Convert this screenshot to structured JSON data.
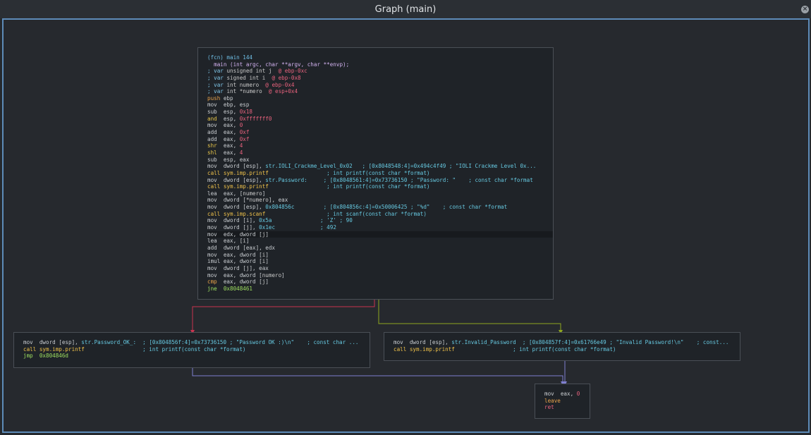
{
  "window": {
    "title": "Graph (main)",
    "close_label": "×"
  },
  "colors": {
    "border_accent": "#5d8bb8",
    "edge_false": "#c8334f",
    "edge_true": "#8fa61e",
    "edge_jump": "#7f7fd0"
  },
  "nodes": {
    "main": {
      "lines": [
        [
          [
            "c-fcn",
            "(fcn) main 144"
          ]
        ],
        [
          [
            "c-sig",
            "  main (int argc, char **argv, char **envp);"
          ]
        ],
        [
          [
            "c-semi",
            "; var "
          ],
          [
            "c-var",
            "unsigned int j "
          ],
          [
            "c-red",
            " @ ebp-0xc"
          ]
        ],
        [
          [
            "c-semi",
            "; var "
          ],
          [
            "c-var",
            "signed int i "
          ],
          [
            "c-red",
            " @ ebp-0x8"
          ]
        ],
        [
          [
            "c-semi",
            "; var "
          ],
          [
            "c-var",
            "int numero "
          ],
          [
            "c-red",
            " @ ebp-0x4"
          ]
        ],
        [
          [
            "c-semi",
            "; var "
          ],
          [
            "c-var",
            "int *numero "
          ],
          [
            "c-red",
            " @ esp+0x4"
          ]
        ],
        [
          [
            "c-push",
            "push "
          ],
          [
            "c-reg",
            "ebp"
          ]
        ],
        [
          [
            "c-mov",
            "mov  "
          ],
          [
            "c-reg",
            "ebp, esp"
          ]
        ],
        [
          [
            "c-mov",
            "sub  "
          ],
          [
            "c-reg",
            "esp, "
          ],
          [
            "c-num",
            "0x18"
          ]
        ],
        [
          [
            "c-and",
            "and  "
          ],
          [
            "c-reg",
            "esp, "
          ],
          [
            "c-num",
            "0xfffffff0"
          ]
        ],
        [
          [
            "c-mov",
            "mov  "
          ],
          [
            "c-reg",
            "eax, "
          ],
          [
            "c-num",
            "0"
          ]
        ],
        [
          [
            "c-mov",
            "add  "
          ],
          [
            "c-reg",
            "eax, "
          ],
          [
            "c-num",
            "0xf"
          ]
        ],
        [
          [
            "c-mov",
            "add  "
          ],
          [
            "c-reg",
            "eax, "
          ],
          [
            "c-num",
            "0xf"
          ]
        ],
        [
          [
            "c-and",
            "shr  "
          ],
          [
            "c-reg",
            "eax, "
          ],
          [
            "c-num",
            "4"
          ]
        ],
        [
          [
            "c-and",
            "shl  "
          ],
          [
            "c-reg",
            "eax, "
          ],
          [
            "c-num",
            "4"
          ]
        ],
        [
          [
            "c-mov",
            "sub  "
          ],
          [
            "c-reg",
            "esp, eax"
          ]
        ],
        [
          [
            "c-mov",
            "mov  "
          ],
          [
            "c-reg",
            "dword [esp], "
          ],
          [
            "c-str",
            "str.IOLI_Crackme_Level_0x02"
          ],
          [
            "c-cmt",
            "   ; [0x8048548:4]=0x494c4f49 ; \"IOLI Crackme Level 0x..."
          ]
        ],
        [
          [
            "c-call",
            "call "
          ],
          [
            "c-sym",
            "sym.imp.printf"
          ],
          [
            "c-cmt",
            "                  ; int printf(const char *format)"
          ]
        ],
        [
          [
            "c-mov",
            "mov  "
          ],
          [
            "c-reg",
            "dword [esp], "
          ],
          [
            "c-str",
            "str.Password:"
          ],
          [
            "c-cmt",
            "     ; [0x8048561:4]=0x73736150 ; \"Password: \"    ; const char *format"
          ]
        ],
        [
          [
            "c-call",
            "call "
          ],
          [
            "c-sym",
            "sym.imp.printf"
          ],
          [
            "c-cmt",
            "                  ; int printf(const char *format)"
          ]
        ],
        [
          [
            "c-mov",
            "lea  "
          ],
          [
            "c-reg",
            "eax, ["
          ],
          [
            "c-var",
            "numero"
          ],
          [
            "c-reg",
            "]"
          ]
        ],
        [
          [
            "c-mov",
            "mov  "
          ],
          [
            "c-reg",
            "dword ["
          ],
          [
            "c-var",
            "*numero"
          ],
          [
            "c-reg",
            "], eax"
          ]
        ],
        [
          [
            "c-mov",
            "mov  "
          ],
          [
            "c-reg",
            "dword [esp], "
          ],
          [
            "c-str",
            "0x804856c"
          ],
          [
            "c-cmt",
            "         ; [0x804856c:4]=0x50006425 ; \"%d\"    ; const char *format"
          ]
        ],
        [
          [
            "c-call",
            "call "
          ],
          [
            "c-sym",
            "sym.imp.scanf"
          ],
          [
            "c-cmt",
            "                   ; int scanf(const char *format)"
          ]
        ],
        [
          [
            "c-mov",
            "mov  "
          ],
          [
            "c-reg",
            "dword ["
          ],
          [
            "c-var",
            "i"
          ],
          [
            "c-reg",
            "], "
          ],
          [
            "c-str",
            "0x5a"
          ],
          [
            "c-cmt",
            "               ; 'Z' ; 90"
          ]
        ],
        [
          [
            "c-mov",
            "mov  "
          ],
          [
            "c-reg",
            "dword ["
          ],
          [
            "c-var",
            "j"
          ],
          [
            "c-reg",
            "], "
          ],
          [
            "c-str",
            "0x1ec"
          ],
          [
            "c-cmt",
            "              ; 492"
          ]
        ],
        [
          [
            "c-mov",
            "mov  "
          ],
          [
            "c-reg",
            "edx, dword ["
          ],
          [
            "c-var",
            "j"
          ],
          [
            "c-reg",
            "]"
          ]
        ],
        [
          [
            "c-mov",
            "lea  "
          ],
          [
            "c-reg",
            "eax, ["
          ],
          [
            "c-var",
            "i"
          ],
          [
            "c-reg",
            "]"
          ]
        ],
        [
          [
            "c-mov",
            "add  "
          ],
          [
            "c-reg",
            "dword [eax], edx"
          ]
        ],
        [
          [
            "c-mov",
            "mov  "
          ],
          [
            "c-reg",
            "eax, dword ["
          ],
          [
            "c-var",
            "i"
          ],
          [
            "c-reg",
            "]"
          ]
        ],
        [
          [
            "c-mov",
            "imul "
          ],
          [
            "c-reg",
            "eax, dword ["
          ],
          [
            "c-var",
            "i"
          ],
          [
            "c-reg",
            "]"
          ]
        ],
        [
          [
            "c-mov",
            "mov  "
          ],
          [
            "c-reg",
            "dword ["
          ],
          [
            "c-var",
            "j"
          ],
          [
            "c-reg",
            "], eax"
          ]
        ],
        [
          [
            "c-mov",
            "mov  "
          ],
          [
            "c-reg",
            "eax, dword ["
          ],
          [
            "c-var",
            "numero"
          ],
          [
            "c-reg",
            "]"
          ]
        ],
        [
          [
            "c-cmp",
            "cmp  "
          ],
          [
            "c-reg",
            "eax, dword ["
          ],
          [
            "c-var",
            "j"
          ],
          [
            "c-reg",
            "]"
          ]
        ],
        [
          [
            "c-jmp",
            "jne  "
          ],
          [
            "c-jmp",
            "0x8048461"
          ]
        ]
      ],
      "highlight_index": 26
    },
    "ok": {
      "lines": [
        [
          [
            "c-mov",
            "mov  "
          ],
          [
            "c-reg",
            "dword [esp], "
          ],
          [
            "c-str",
            "str.Password_OK_:"
          ],
          [
            "c-cmt",
            "  ; [0x804856f:4]=0x73736150 ; \"Password OK :)\\n\"    ; const char ..."
          ]
        ],
        [
          [
            "c-call",
            "call "
          ],
          [
            "c-sym",
            "sym.imp.printf"
          ],
          [
            "c-cmt",
            "                  ; int printf(const char *format)"
          ]
        ],
        [
          [
            "c-jmp",
            "jmp  "
          ],
          [
            "c-jmp",
            "0x804846d"
          ]
        ]
      ]
    },
    "invalid": {
      "lines": [
        [
          [
            "c-mov",
            "mov  "
          ],
          [
            "c-reg",
            "dword [esp], "
          ],
          [
            "c-str",
            "str.Invalid_Password"
          ],
          [
            "c-cmt",
            "  ; [0x804857f:4]=0x61766e49 ; \"Invalid Password!\\n\"    ; const..."
          ]
        ],
        [
          [
            "c-call",
            "call "
          ],
          [
            "c-sym",
            "sym.imp.printf"
          ],
          [
            "c-cmt",
            "                  ; int printf(const char *format)"
          ]
        ]
      ]
    },
    "exit": {
      "lines": [
        [
          [
            "c-mov",
            "mov  "
          ],
          [
            "c-reg",
            "eax, "
          ],
          [
            "c-num",
            "0"
          ]
        ],
        [
          [
            "c-leave",
            "leave"
          ]
        ],
        [
          [
            "c-ret",
            "ret"
          ]
        ]
      ]
    }
  }
}
